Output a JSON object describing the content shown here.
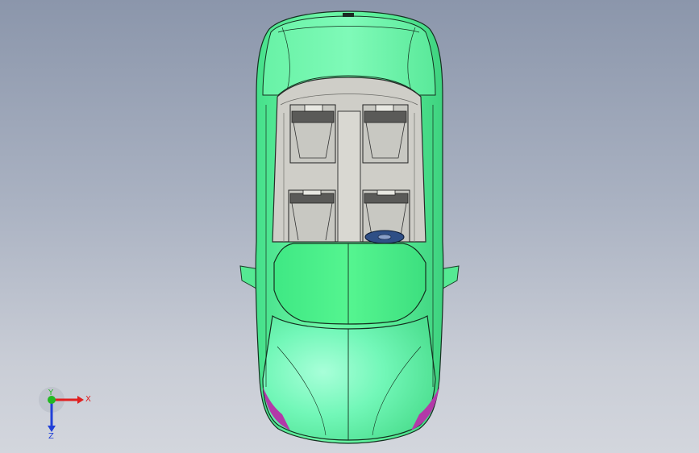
{
  "viewport": {
    "background_top": "#8b96ab",
    "background_bottom": "#d3d6dd"
  },
  "model": {
    "body_color": "#5ff59b",
    "interior_color": "#cfcec8",
    "seat_color": "#c8c8c2",
    "accent_color": "#b23aa8",
    "speaker_color": "#2f4f86"
  },
  "triad": {
    "x_label": "X",
    "y_label": "Y",
    "z_label": "Z",
    "x_color": "#e02020",
    "y_color": "#22b822",
    "z_color": "#2040d8"
  }
}
